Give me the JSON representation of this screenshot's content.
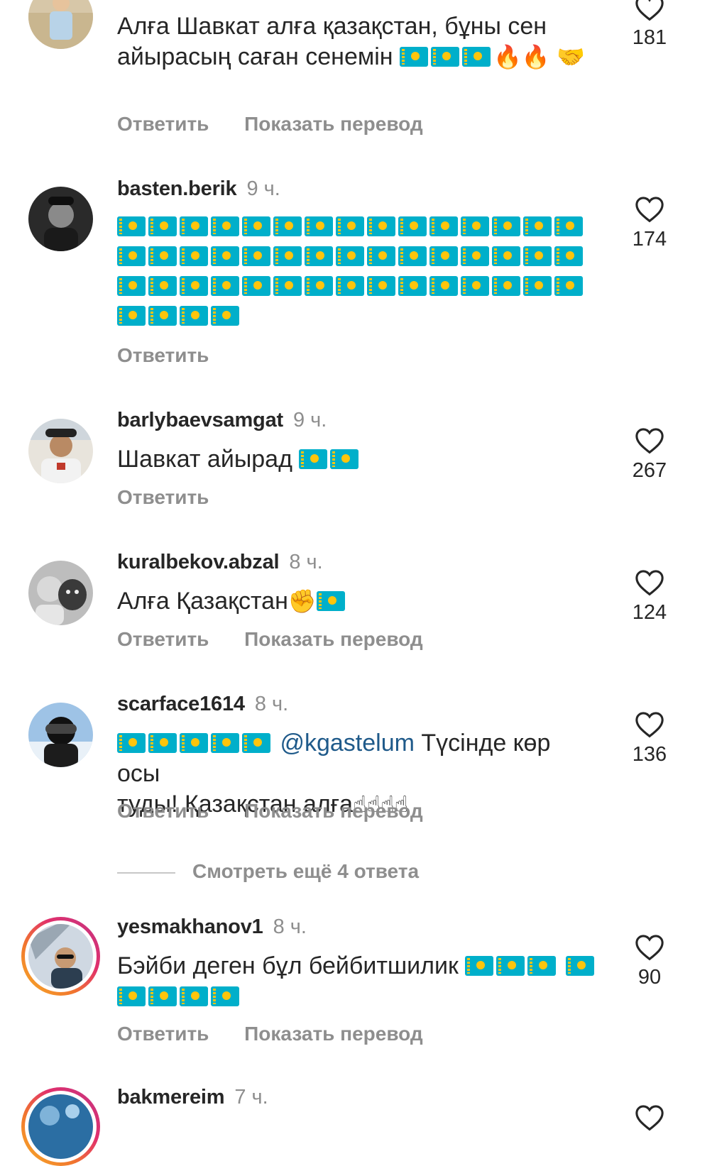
{
  "comments": [
    {
      "username": "",
      "time": "",
      "text": "Алға Шавкат алға қазақстан, бұны сен айырасың саған сенемін",
      "likes": "181",
      "reply_label": "Ответить",
      "translate_label": "Показать перевод",
      "emoji": [
        "kz-flag",
        "kz-flag",
        "kz-flag",
        "🔥",
        "🔥",
        "🤝"
      ]
    },
    {
      "username": "basten.berik",
      "time": "9 ч.",
      "text": "",
      "likes": "174",
      "reply_label": "Ответить",
      "emoji_flag_count": 49
    },
    {
      "username": "barlybaevsamgat",
      "time": "9 ч.",
      "text": "Шавкат айырад",
      "likes": "267",
      "reply_label": "Ответить",
      "emoji": [
        "kz-flag",
        "kz-flag"
      ]
    },
    {
      "username": "kuralbekov.abzal",
      "time": "8 ч.",
      "text": "Алға Қазақстан",
      "likes": "124",
      "reply_label": "Ответить",
      "translate_label": "Показать перевод",
      "emoji": [
        "✊",
        "kz-flag"
      ]
    },
    {
      "username": "scarface1614",
      "time": "8 ч.",
      "mention": "@kgastelum",
      "text_line1": " Түсінде көр осы",
      "text_line2": "туды! Қазақстан алға",
      "likes": "136",
      "reply_label": "Ответить",
      "translate_label": "Показать перевод",
      "emoji": [
        "kz-flag",
        "kz-flag",
        "kz-flag",
        "kz-flag",
        "kz-flag",
        "☝",
        "☝",
        "☝",
        "☝"
      ]
    },
    {
      "username": "yesmakhanov1",
      "time": "8 ч.",
      "text": "Бэйби деген бұл бейбитшилик",
      "likes": "90",
      "reply_label": "Ответить",
      "translate_label": "Показать перевод",
      "emoji": [
        "kz-flag",
        "kz-flag",
        "kz-flag",
        "kz-flag",
        "kz-flag",
        "kz-flag",
        "kz-flag",
        "kz-flag"
      ]
    },
    {
      "username": "bakmereim",
      "time": "7 ч."
    }
  ],
  "view_more_label": "Смотреть ещё 4 ответа",
  "icons": {
    "like": "heart-outline-icon",
    "flag": "kazakhstan-flag-icon"
  },
  "colors": {
    "text": "#262626",
    "secondary": "#8e8e8e",
    "mention": "#1f5a8a",
    "flag_blue": "#00afca",
    "flag_gold": "#fec50c"
  }
}
